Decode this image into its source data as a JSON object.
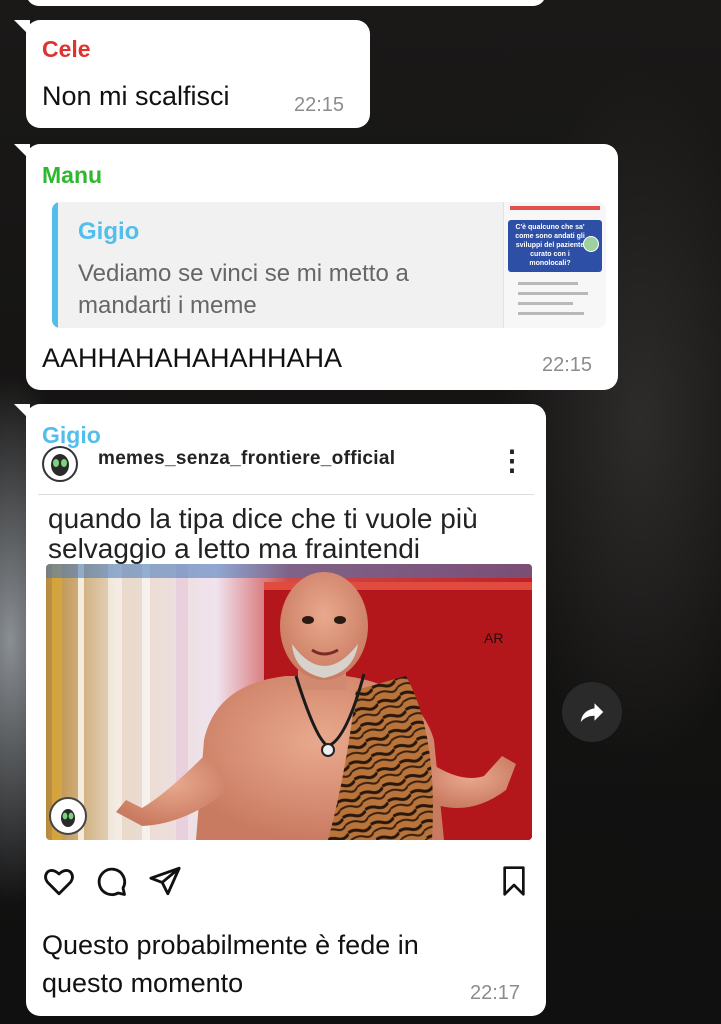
{
  "messages": [
    {
      "sender": "Cele",
      "sender_color": "#e0322f",
      "text": "Non mi scalfisci",
      "time": "22:15"
    },
    {
      "sender": "Manu",
      "sender_color": "#2eb82e",
      "quote": {
        "sender": "Gigio",
        "text": "Vediamo se vinci se mi metto a mandarti i meme",
        "thumbnail_text": "C'è qualcuno che sa' come sono andati gli sviluppi del paziente curato con i monolocali?"
      },
      "text": "AAHHAHAHAHAHHAHA",
      "time": "22:15"
    },
    {
      "sender": "Gigio",
      "sender_color": "#53bdeb",
      "embed": {
        "username": "memes_senza_frontiere_official",
        "meme_caption": "quando la tipa dice che ti vuole più selvaggio a letto ma fraintendi",
        "watermark": "AR"
      },
      "text": "Questo probabilmente è fede in questo momento",
      "time": "22:17"
    }
  ],
  "icons": {
    "like": "heart-icon",
    "comment": "comment-icon",
    "share": "send-icon",
    "save": "bookmark-icon",
    "forward": "forward-icon"
  }
}
